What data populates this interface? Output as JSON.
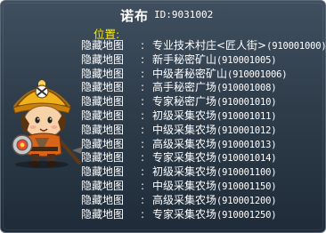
{
  "npc": {
    "name": "诺布",
    "id_text": "ID:9031002"
  },
  "section_label": "位置:",
  "locations": [
    {
      "prefix": "隐藏地图",
      "sep": ":",
      "name": "专业技术村庄<匠人街>",
      "id": "(910001000)"
    },
    {
      "prefix": "隐藏地图",
      "sep": ":",
      "name": "新手秘密矿山",
      "id": "(910001005)"
    },
    {
      "prefix": "隐藏地图",
      "sep": ":",
      "name": "中级者秘密矿山",
      "id": "(910001006)"
    },
    {
      "prefix": "隐藏地图",
      "sep": ":",
      "name": "高手秘密广场",
      "id": "(910001008)"
    },
    {
      "prefix": "隐藏地图",
      "sep": ":",
      "name": "专家秘密广场",
      "id": "(910001010)"
    },
    {
      "prefix": "隐藏地图",
      "sep": ":",
      "name": "初级采集农场",
      "id": "(910001011)"
    },
    {
      "prefix": "隐藏地图",
      "sep": ":",
      "name": "中级采集农场",
      "id": "(910001012)"
    },
    {
      "prefix": "隐藏地图",
      "sep": ":",
      "name": "高级采集农场",
      "id": "(910001013)"
    },
    {
      "prefix": "隐藏地图",
      "sep": ":",
      "name": "专家采集农场",
      "id": "(910001014)"
    },
    {
      "prefix": "隐藏地图",
      "sep": ":",
      "name": "初级采集农场",
      "id": "(910001100)"
    },
    {
      "prefix": "隐藏地图",
      "sep": ":",
      "name": "中级采集农场",
      "id": "(910001150)"
    },
    {
      "prefix": "隐藏地图",
      "sep": ":",
      "name": "高级采集农场",
      "id": "(910001200)"
    },
    {
      "prefix": "隐藏地图",
      "sep": ":",
      "name": "专家采集农场",
      "id": "(910001250)"
    }
  ],
  "colors": {
    "panel_top": "#404f5f",
    "panel_bottom": "#1f2b38",
    "section_label": "#ffea00",
    "text": "#ffffff"
  },
  "icons": {
    "portrait": "npc-miner-portrait"
  }
}
